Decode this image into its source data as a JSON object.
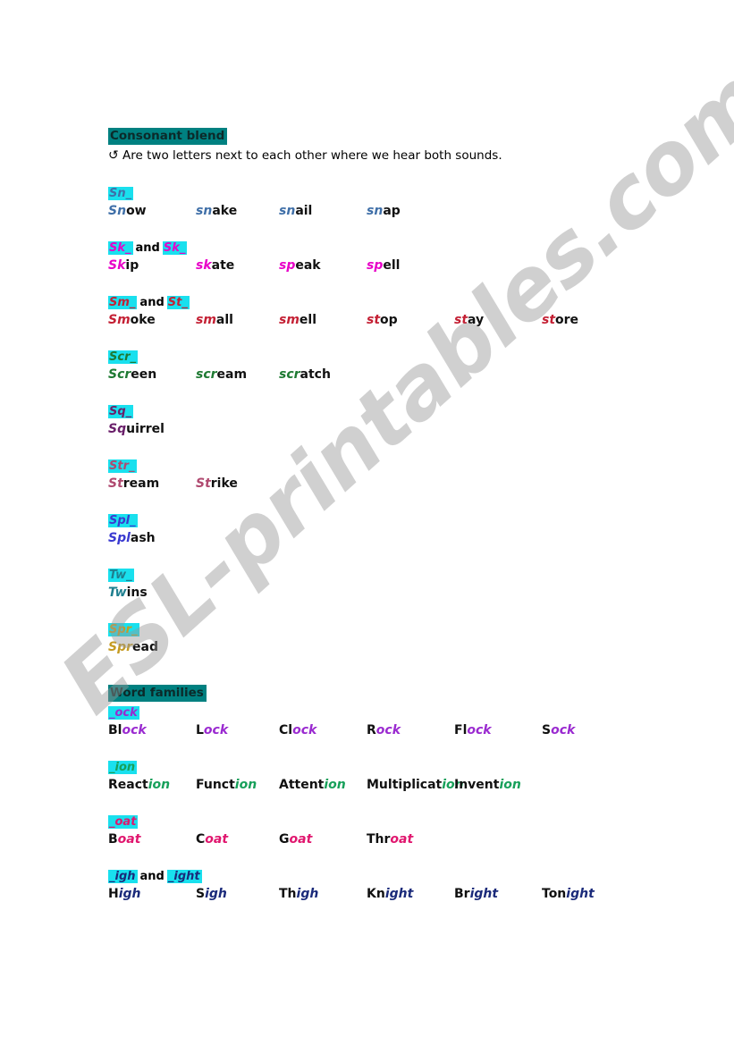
{
  "watermark": {
    "text": "ESL-printables.com"
  },
  "colors": {
    "header_bg": "#008080",
    "highlight": "#19e0ee",
    "text": "#111111",
    "sn": "#3f6fa8",
    "sk": "#e800c8",
    "sm": "#c42034",
    "scr": "#1f7a33",
    "sq": "#6a1f6a",
    "str": "#b04a70",
    "spl": "#3a3ad0",
    "tw": "#1f7f8f",
    "spr": "#c59b22",
    "ock": "#9a2ad0",
    "ion": "#17a05a",
    "oat": "#e0166e",
    "igh": "#1a2a7a"
  },
  "sections": [
    {
      "id": "consonant-blend",
      "header": "Consonant blend",
      "intro_arrow": "↺",
      "intro": "Are two letters next to each other where we hear both sounds.",
      "groups": [
        {
          "id": "sn",
          "labels": [
            "Sn_"
          ],
          "conjunction": "",
          "color": "#3f6fa8",
          "words": [
            {
              "hl": "Sn",
              "rest": "ow"
            },
            {
              "hl": "sn",
              "rest": "ake"
            },
            {
              "hl": "sn",
              "rest": "ail"
            },
            {
              "hl": "sn",
              "rest": "ap"
            }
          ]
        },
        {
          "id": "sk-sp",
          "labels": [
            "Sk_",
            "Sk_"
          ],
          "conjunction": "and",
          "color": "#e800c8",
          "words": [
            {
              "hl": "Sk",
              "rest": "ip"
            },
            {
              "hl": "sk",
              "rest": "ate"
            },
            {
              "hl": "sp",
              "rest": "eak"
            },
            {
              "hl": "sp",
              "rest": "ell"
            }
          ]
        },
        {
          "id": "sm-st",
          "labels": [
            "Sm_",
            "St_"
          ],
          "conjunction": "and",
          "color": "#c42034",
          "words": [
            {
              "hl": "Sm",
              "rest": "oke"
            },
            {
              "hl": "sm",
              "rest": "all"
            },
            {
              "hl": "sm",
              "rest": "ell"
            },
            {
              "hl": "st",
              "rest": "op"
            },
            {
              "hl": "st",
              "rest": "ay"
            },
            {
              "hl": "st",
              "rest": "ore"
            }
          ]
        },
        {
          "id": "scr",
          "labels": [
            "Scr_"
          ],
          "conjunction": "",
          "color": "#1f7a33",
          "words": [
            {
              "hl": "Scr",
              "rest": "een"
            },
            {
              "hl": "scr",
              "rest": "eam"
            },
            {
              "hl": "scr",
              "rest": "atch"
            }
          ]
        },
        {
          "id": "sq",
          "labels": [
            "Sq_"
          ],
          "conjunction": "",
          "color": "#6a1f6a",
          "words": [
            {
              "hl": "Sq",
              "rest": "uirrel"
            }
          ]
        },
        {
          "id": "str",
          "labels": [
            "Str_"
          ],
          "conjunction": "",
          "color": "#b04a70",
          "words": [
            {
              "hl": "St",
              "rest": "ream"
            },
            {
              "hl": "St",
              "rest": "rike"
            }
          ]
        },
        {
          "id": "spl",
          "labels": [
            "Spl_"
          ],
          "conjunction": "",
          "color": "#3a3ad0",
          "words": [
            {
              "hl": "Spl",
              "rest": "ash"
            }
          ]
        },
        {
          "id": "tw",
          "labels": [
            "Tw_"
          ],
          "conjunction": "",
          "color": "#1f7f8f",
          "words": [
            {
              "hl": "Tw",
              "rest": "ins"
            }
          ]
        },
        {
          "id": "spr",
          "labels": [
            "Spr_"
          ],
          "conjunction": "",
          "color": "#c59b22",
          "words": [
            {
              "hl": "Spr",
              "rest": "ead"
            }
          ]
        }
      ]
    },
    {
      "id": "word-families",
      "header": "Word families",
      "intro_arrow": "",
      "intro": "",
      "groups": [
        {
          "id": "ock",
          "labels": [
            "_ock"
          ],
          "conjunction": "",
          "color": "#9a2ad0",
          "words": [
            {
              "pre": "Bl",
              "hl": "ock"
            },
            {
              "pre": "L",
              "hl": "ock"
            },
            {
              "pre": "Cl",
              "hl": "ock"
            },
            {
              "pre": "R",
              "hl": "ock"
            },
            {
              "pre": "Fl",
              "hl": "ock"
            },
            {
              "pre": "S",
              "hl": "ock"
            }
          ]
        },
        {
          "id": "ion",
          "labels": [
            "_ion"
          ],
          "conjunction": "",
          "color": "#17a05a",
          "words": [
            {
              "pre": "React",
              "hl": "ion"
            },
            {
              "pre": "Funct",
              "hl": "ion"
            },
            {
              "pre": "Attent",
              "hl": "ion"
            },
            {
              "pre": "Multiplicat",
              "hl": "ion"
            },
            {
              "pre": "Invent",
              "hl": "ion"
            }
          ]
        },
        {
          "id": "oat",
          "labels": [
            "_oat"
          ],
          "conjunction": "",
          "color": "#e0166e",
          "words": [
            {
              "pre": "B",
              "hl": "oat"
            },
            {
              "pre": "C",
              "hl": "oat"
            },
            {
              "pre": "G",
              "hl": "oat"
            },
            {
              "pre": "Thr",
              "hl": "oat"
            }
          ]
        },
        {
          "id": "igh-ight",
          "labels": [
            "_igh",
            "_ight"
          ],
          "conjunction": "and",
          "color": "#1a2a7a",
          "words": [
            {
              "pre": "H",
              "hl": "igh"
            },
            {
              "pre": "S",
              "hl": "igh"
            },
            {
              "pre": "Th",
              "hl": "igh"
            },
            {
              "pre": "Kn",
              "hl": "ight"
            },
            {
              "pre": "Br",
              "hl": "ight"
            },
            {
              "pre": "Ton",
              "hl": "ight"
            }
          ]
        }
      ]
    }
  ]
}
